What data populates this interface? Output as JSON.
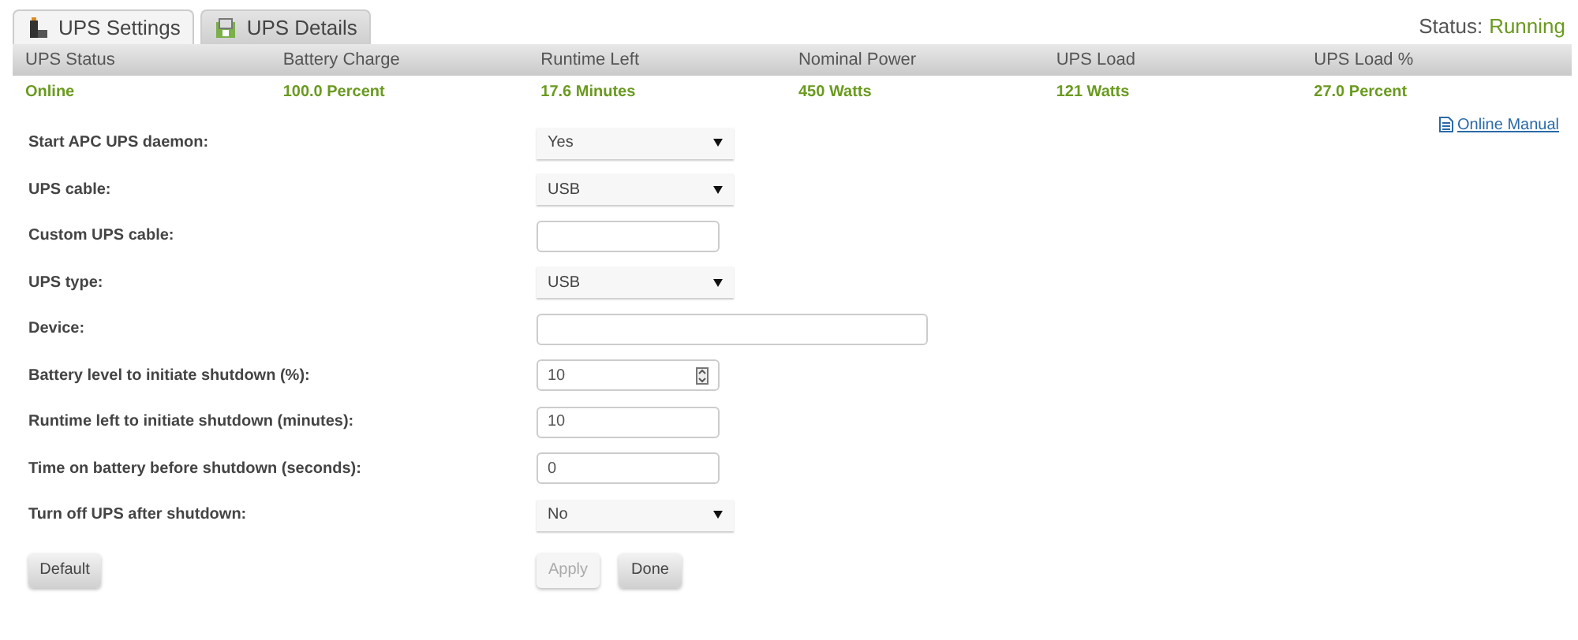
{
  "tabs": [
    {
      "label": "UPS Settings",
      "selected": true
    },
    {
      "label": "UPS Details",
      "selected": false
    }
  ],
  "status": {
    "label": "Status:",
    "value": "Running"
  },
  "summary": {
    "columns": [
      "UPS Status",
      "Battery Charge",
      "Runtime Left",
      "Nominal Power",
      "UPS Load",
      "UPS Load %"
    ],
    "values": [
      "Online",
      "100.0 Percent",
      "17.6 Minutes",
      "450 Watts",
      "121 Watts",
      "27.0 Percent"
    ]
  },
  "manual_link": "Online Manual",
  "fields": [
    {
      "label": "Start APC UPS daemon:",
      "kind": "select",
      "value": "Yes"
    },
    {
      "label": "UPS cable:",
      "kind": "select",
      "value": "USB"
    },
    {
      "label": "Custom UPS cable:",
      "kind": "text"
    },
    {
      "label": "UPS type:",
      "kind": "select",
      "value": "USB"
    },
    {
      "label": "Device:",
      "kind": "wide"
    },
    {
      "label": "Battery level to initiate shutdown (%):",
      "kind": "number",
      "value": "10"
    },
    {
      "label": "Runtime left to initiate shutdown (minutes):",
      "kind": "text",
      "value": "10"
    },
    {
      "label": "Time on battery before shutdown (seconds):",
      "kind": "text",
      "value": "0"
    },
    {
      "label": "Turn off UPS after shutdown:",
      "kind": "select",
      "value": "No"
    }
  ],
  "buttons": [
    {
      "label": "Default",
      "disabled": false
    },
    {
      "label": "Apply",
      "disabled": true
    },
    {
      "label": "Done",
      "disabled": false
    }
  ]
}
